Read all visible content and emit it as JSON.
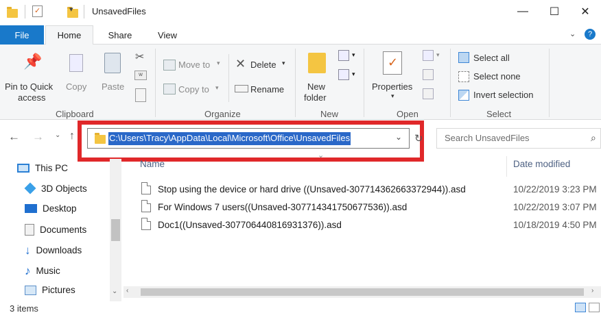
{
  "window": {
    "title": "UnsavedFiles",
    "minimize": "—",
    "maximize": "☐",
    "close": "✕"
  },
  "tabs": [
    "File",
    "Home",
    "Share",
    "View"
  ],
  "ribbon": {
    "clipboard": {
      "pin_label_1": "Pin to Quick",
      "pin_label_2": "access",
      "copy": "Copy",
      "paste": "Paste",
      "group": "Clipboard"
    },
    "organize": {
      "move_to": "Move to",
      "copy_to": "Copy to",
      "delete": "Delete",
      "rename": "Rename",
      "group": "Organize"
    },
    "new": {
      "new_folder_1": "New",
      "new_folder_2": "folder",
      "group": "New"
    },
    "open": {
      "properties": "Properties",
      "group": "Open"
    },
    "select": {
      "select_all": "Select all",
      "select_none": "Select none",
      "invert_selection": "Invert selection",
      "group": "Select"
    }
  },
  "address": {
    "path": "C:\\Users\\Tracy\\AppData\\Local\\Microsoft\\Office\\UnsavedFiles"
  },
  "search": {
    "placeholder": "Search UnsavedFiles"
  },
  "nav": {
    "items": [
      "This PC",
      "3D Objects",
      "Desktop",
      "Documents",
      "Downloads",
      "Music",
      "Pictures"
    ]
  },
  "columns": {
    "name": "Name",
    "date_modified": "Date modified"
  },
  "files": [
    {
      "name": "Stop using the device or hard drive ((Unsaved-307714362663372944)).asd",
      "date": "10/22/2019 3:23 PM"
    },
    {
      "name": "For Windows 7 users((Unsaved-307714341750677536)).asd",
      "date": "10/22/2019 3:07 PM"
    },
    {
      "name": "Doc1((Unsaved-307706440816931376)).asd",
      "date": "10/18/2019 4:50 PM"
    }
  ],
  "status": {
    "item_count": "3 items"
  },
  "colors": {
    "file_tab": "#1979ca",
    "selection": "#2a68c8",
    "highlight_box": "#e0282a"
  }
}
